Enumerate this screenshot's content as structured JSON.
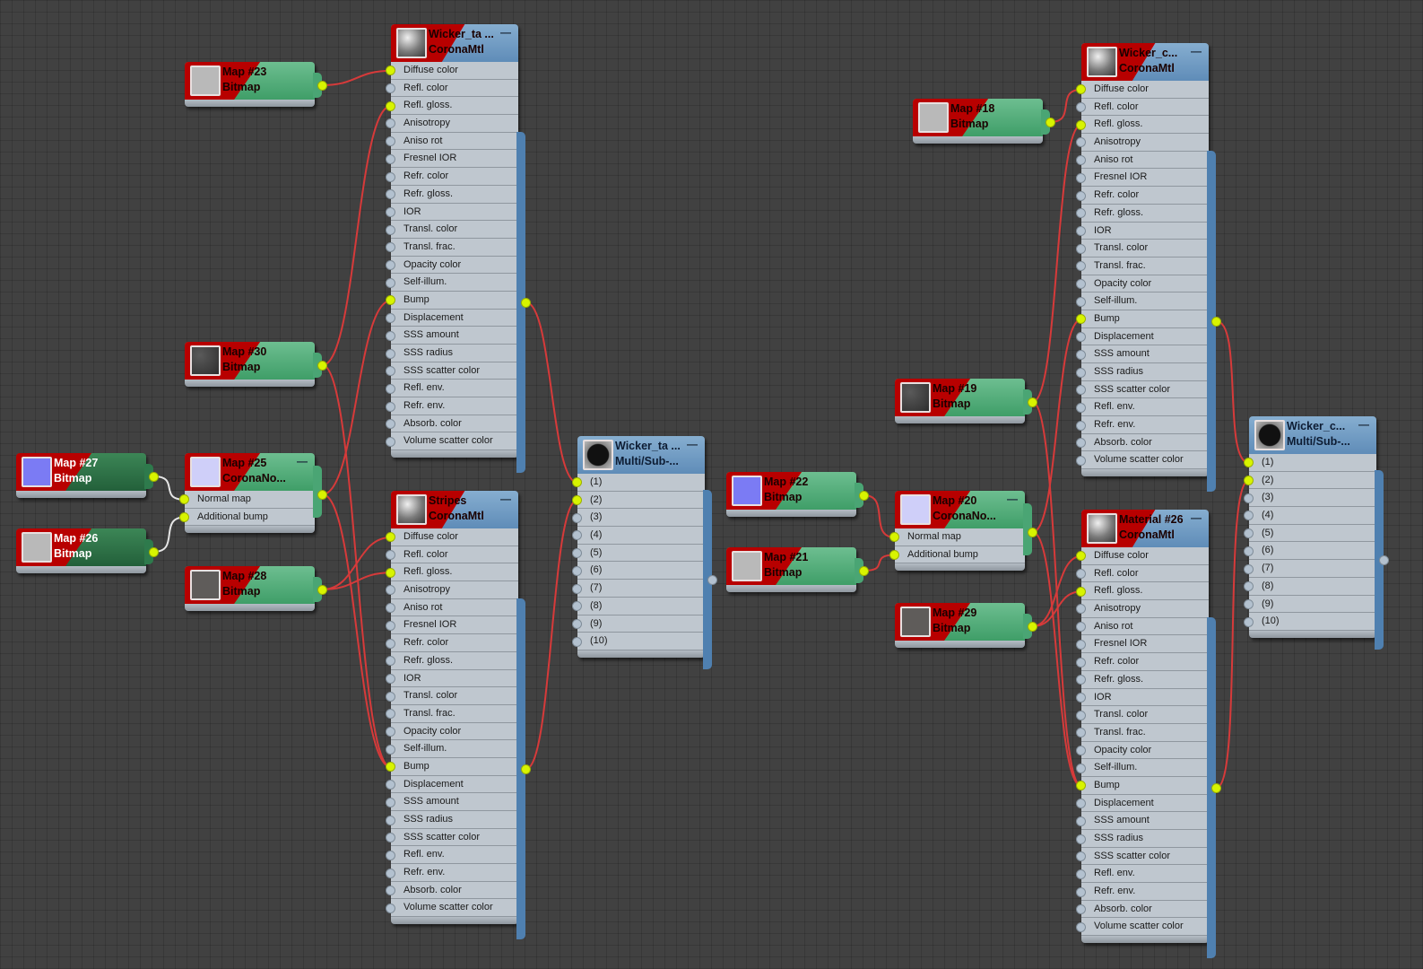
{
  "colors": {
    "canvas": "#414141",
    "wire_active": "#d63a3a",
    "wire_white": "#e6e6e6",
    "socket_connected": "#d8f400",
    "socket_empty": "#b3c1cf",
    "material_header": "#6f9ac4",
    "map_header": "#55b07d",
    "selected_red": "#b80000"
  },
  "corona_slots": [
    "Diffuse color",
    "Refl. color",
    "Refl. gloss.",
    "Anisotropy",
    "Aniso rot",
    "Fresnel IOR",
    "Refr. color",
    "Refr. gloss.",
    "IOR",
    "Transl. color",
    "Transl. frac.",
    "Opacity color",
    "Self-illum.",
    "Bump",
    "Displacement",
    "SSS amount",
    "SSS radius",
    "SSS scatter color",
    "Refl. env.",
    "Refr. env.",
    "Absorb. color",
    "Volume scatter color"
  ],
  "multi_slots": [
    "(1)",
    "(2)",
    "(3)",
    "(4)",
    "(5)",
    "(6)",
    "(7)",
    "(8)",
    "(9)",
    "(10)"
  ],
  "normal_slots": [
    "Normal map",
    "Additional bump"
  ],
  "nodes": {
    "map23": {
      "name": "Map #23",
      "type": "Bitmap",
      "icon": "gray-bitmap-thumbnail"
    },
    "map30": {
      "name": "Map #30",
      "type": "Bitmap",
      "icon": "dark-noise-thumbnail"
    },
    "map27": {
      "name": "Map #27",
      "type": "Bitmap",
      "icon": "blue-normal-thumbnail"
    },
    "map26": {
      "name": "Map #26",
      "type": "Bitmap",
      "icon": "gray-bitmap-thumbnail"
    },
    "map25": {
      "name": "Map #25",
      "type": "CoronaNo...",
      "icon": "light-normal-thumbnail"
    },
    "map28": {
      "name": "Map #28",
      "type": "Bitmap",
      "icon": "dark-gray-thumbnail"
    },
    "mtlWickerTa": {
      "name": "Wicker_ta ...",
      "type": "CoronaMtl",
      "icon": "sphere-icon"
    },
    "mtlStripes": {
      "name": "Stripes",
      "type": "CoronaMtl",
      "icon": "sphere-icon"
    },
    "multiWickerTa": {
      "name": "Wicker_ta ...",
      "type": "Multi/Sub-...",
      "icon": "multi-sub-icon"
    },
    "map22": {
      "name": "Map #22",
      "type": "Bitmap",
      "icon": "blue-normal-thumbnail"
    },
    "map21": {
      "name": "Map #21",
      "type": "Bitmap",
      "icon": "gray-bitmap-thumbnail"
    },
    "map20": {
      "name": "Map #20",
      "type": "CoronaNo...",
      "icon": "light-normal-thumbnail"
    },
    "map18": {
      "name": "Map #18",
      "type": "Bitmap",
      "icon": "gray-bitmap-thumbnail"
    },
    "map19": {
      "name": "Map #19",
      "type": "Bitmap",
      "icon": "dark-noise-thumbnail"
    },
    "map29": {
      "name": "Map #29",
      "type": "Bitmap",
      "icon": "dark-gray-thumbnail"
    },
    "mtlWickerC": {
      "name": "Wicker_c...",
      "type": "CoronaMtl",
      "icon": "sphere-icon"
    },
    "mtl26": {
      "name": "Material #26",
      "type": "CoronaMtl",
      "icon": "sphere-icon"
    },
    "multiWickerC": {
      "name": "Wicker_c...",
      "type": "Multi/Sub-...",
      "icon": "multi-sub-icon"
    }
  }
}
